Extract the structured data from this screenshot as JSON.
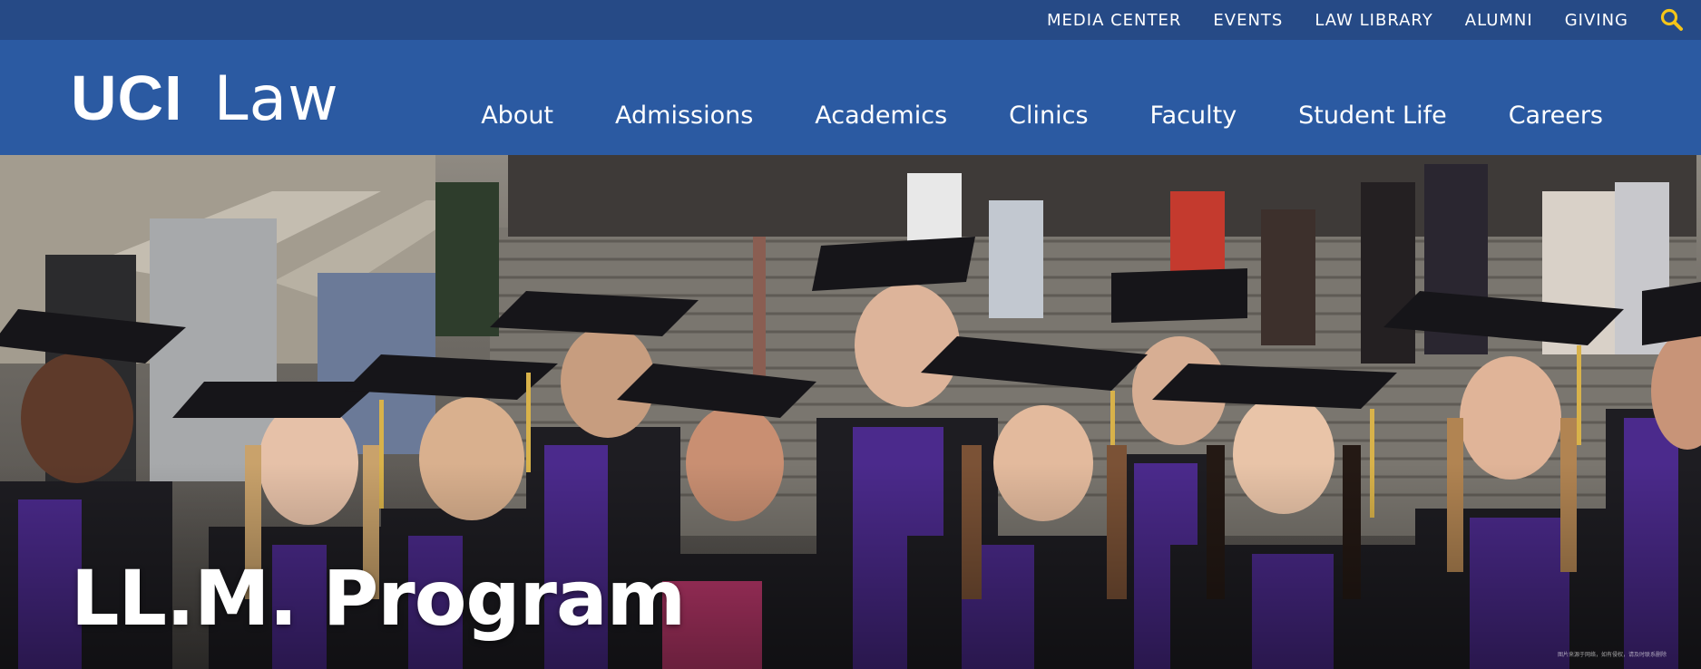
{
  "utility_nav": {
    "items": [
      "MEDIA CENTER",
      "EVENTS",
      "LAW LIBRARY",
      "ALUMNI",
      "GIVING"
    ],
    "search_icon": "search-icon"
  },
  "logo": {
    "primary": "UCI",
    "secondary": "Law"
  },
  "main_nav": {
    "items": [
      "About",
      "Admissions",
      "Academics",
      "Clinics",
      "Faculty",
      "Student Life",
      "Careers"
    ]
  },
  "hero": {
    "title": "LL.M. Program",
    "image_description_icon": "graduation-photo",
    "watermark": "图片来源于网络，如有侵权，请及时联系删除"
  },
  "colors": {
    "utility_bar": "#264a86",
    "header": "#2b5aa2",
    "search_icon": "#f5c518",
    "gown_purple": "#4b2a8c"
  }
}
